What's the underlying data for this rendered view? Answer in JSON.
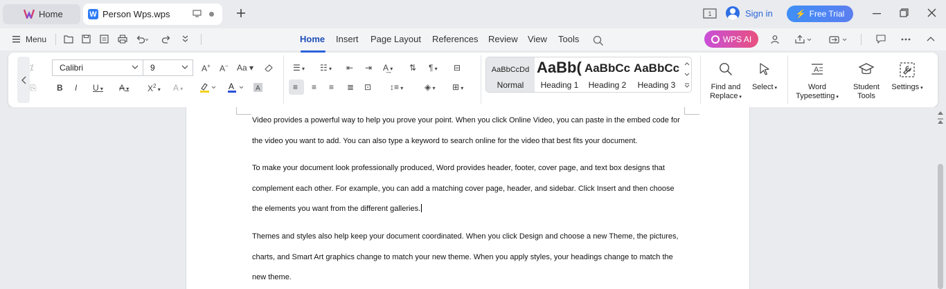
{
  "titlebar": {
    "home_tab": "Home",
    "doc_tab": "Person Wps.wps",
    "sign_in": "Sign in",
    "free_trial": "Free Trial"
  },
  "menu": {
    "menu_label": "Menu",
    "ribbon_tabs": [
      "Home",
      "Insert",
      "Page Layout",
      "References",
      "Review",
      "View",
      "Tools"
    ],
    "active_tab": "Home",
    "wps_ai": "WPS AI"
  },
  "ribbon": {
    "font_name": "Calibri",
    "font_size": "9",
    "styles": [
      {
        "preview": "AaBbCcDd",
        "name": "Normal",
        "selected": true
      },
      {
        "preview": "AaBb(",
        "name": "Heading 1",
        "selected": false
      },
      {
        "preview": "AaBbCc",
        "name": "Heading 2",
        "selected": false
      },
      {
        "preview": "AaBbCc",
        "name": "Heading 3",
        "selected": false
      }
    ],
    "find_replace_line1": "Find and",
    "find_replace_line2": "Replace",
    "select": "Select",
    "word_typesetting_line1": "Word",
    "word_typesetting_line2": "Typesetting",
    "student_tools_line1": "Student",
    "student_tools_line2": "Tools",
    "settings": "Settings"
  },
  "document": {
    "paragraphs": [
      [
        "Video provides a powerful way to help you prove your point. When you click Online Video, you can paste in the embed code for",
        "the video you want to add. You can also type a keyword to search online for the video that best fits your document."
      ],
      [
        "To make your document look professionally produced, Word provides header, footer, cover page, and text box designs that",
        "complement each other. For example, you can add a matching cover page, header, and sidebar. Click Insert and then choose",
        "the elements you want from the different galleries."
      ],
      [
        "Themes and styles also help keep your document coordinated. When you click Design and choose a new Theme, the pictures,",
        "charts, and Smart Art graphics change to match your new theme. When you apply styles, your headings change to match the",
        "new theme."
      ]
    ]
  },
  "colors": {
    "accent": "#2b63dd",
    "font_highlight": "#f5d21f",
    "font_color": "#2b4ed8",
    "wps_ai_gradient_start": "#c84fd8",
    "wps_ai_gradient_end": "#e8517f",
    "free_trial_bg": "#3f8ff7"
  }
}
